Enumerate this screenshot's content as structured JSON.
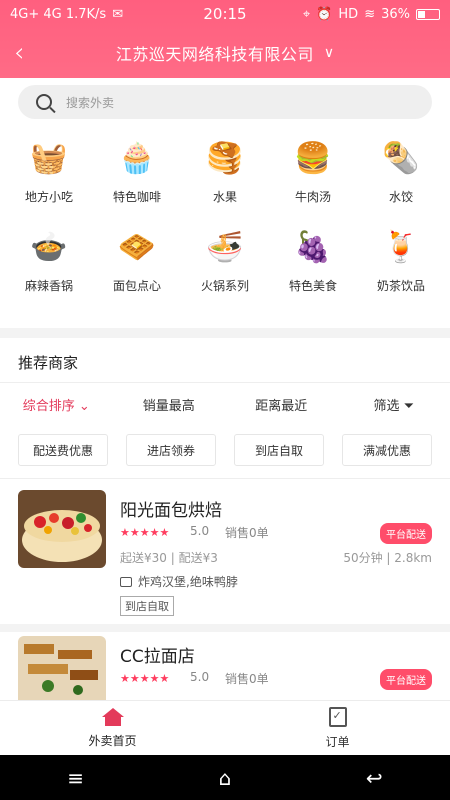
{
  "status": {
    "left": "4G+ 4G 1.7K/s",
    "time": "20:15",
    "right_icons": "HD",
    "battery": "36%"
  },
  "header": {
    "title": "江苏巡天网络科技有限公司"
  },
  "search": {
    "placeholder": "搜索外卖"
  },
  "categories": [
    {
      "label": "地方小吃",
      "icon": "basket-icon",
      "glyph": "🧺"
    },
    {
      "label": "特色咖啡",
      "icon": "cupcake-icon",
      "glyph": "🧁"
    },
    {
      "label": "水果",
      "icon": "pancake-icon",
      "glyph": "🥞"
    },
    {
      "label": "牛肉汤",
      "icon": "burger-icon",
      "glyph": "🍔"
    },
    {
      "label": "水饺",
      "icon": "wrap-icon",
      "glyph": "🌯"
    },
    {
      "label": "麻辣香锅",
      "icon": "pot-icon",
      "glyph": "🍲"
    },
    {
      "label": "面包点心",
      "icon": "waffle-icon",
      "glyph": "🧇"
    },
    {
      "label": "火锅系列",
      "icon": "noodle-bowl-icon",
      "glyph": "🍜"
    },
    {
      "label": "特色美食",
      "icon": "fruit-basket-icon",
      "glyph": "🍇"
    },
    {
      "label": "奶茶饮品",
      "icon": "drink-icon",
      "glyph": "🍹"
    }
  ],
  "section_title": "推荐商家",
  "sort_options": [
    "综合排序",
    "销量最高",
    "距离最近",
    "筛选"
  ],
  "filters": [
    "配送费优惠",
    "进店领券",
    "到店自取",
    "满减优惠"
  ],
  "shops": [
    {
      "name": "阳光面包烘焙",
      "stars": "★★★★★",
      "score": "5.0",
      "sales": "销售0单",
      "badge": "平台配送",
      "fee": "起送¥30 | 配送¥3",
      "distance": "50分钟 | 2.8km",
      "tagline": "炸鸡汉堡,绝味鸭脖",
      "pickup": "到店自取"
    },
    {
      "name": "CC拉面店",
      "stars": "★★★★★",
      "score": "5.0",
      "sales": "销售0单",
      "badge": "平台配送"
    }
  ],
  "bottom_nav": {
    "home": "外卖首页",
    "orders": "订单"
  },
  "colors": {
    "accent": "#ff5f7f",
    "active": "#e33a5a"
  }
}
